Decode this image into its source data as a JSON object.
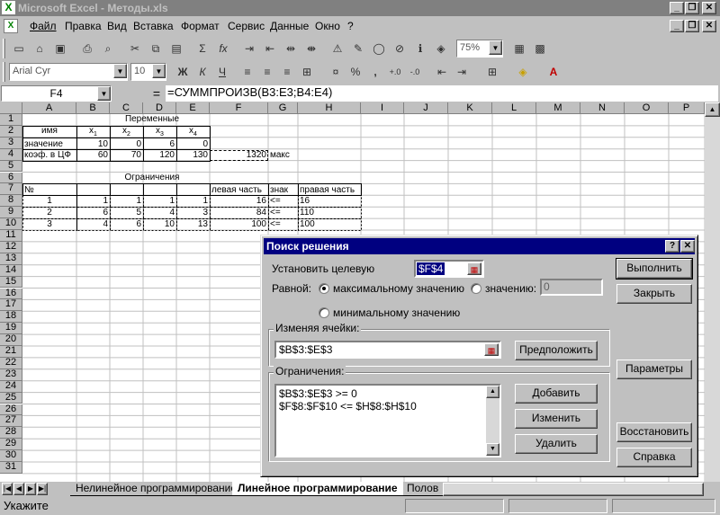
{
  "window": {
    "title": "Microsoft Excel - Методы.xls",
    "app_icon_letter": "X"
  },
  "menu": [
    "Файл",
    "Правка",
    "Вид",
    "Вставка",
    "Формат",
    "Сервис",
    "Данные",
    "Окно",
    "?"
  ],
  "toolbar": {
    "zoom": "75%",
    "font_name": "Arial Cyr",
    "font_size": "10",
    "bold": "Ж",
    "italic": "К",
    "underline": "Ч",
    "percent": "%",
    "comma": ","
  },
  "formula_bar": {
    "name_box": "F4",
    "equals": "=",
    "formula": "=СУММПРОИЗВ(B3:E3;B4:E4)"
  },
  "columns": [
    "A",
    "B",
    "C",
    "D",
    "E",
    "F",
    "G",
    "H",
    "I",
    "J",
    "K",
    "L",
    "M",
    "N",
    "O",
    "P"
  ],
  "rows": [
    "1",
    "2",
    "3",
    "4",
    "5",
    "6",
    "7",
    "8",
    "9",
    "10",
    "11",
    "12",
    "13",
    "14",
    "15",
    "16",
    "17",
    "18",
    "19",
    "20",
    "21",
    "22",
    "23",
    "24",
    "25",
    "26",
    "27",
    "28",
    "29",
    "30",
    "31"
  ],
  "sheet": {
    "variables_title": "Переменные",
    "name_header": "имя",
    "x_headers": [
      "x1",
      "x2",
      "x3",
      "x4"
    ],
    "row_value_label": "значение",
    "values": [
      "10",
      "0",
      "6",
      "0"
    ],
    "row_coef_label": "коэф. в ЦФ",
    "coefs": [
      "60",
      "70",
      "120",
      "130"
    ],
    "objective_value": "1320",
    "objective_label": "макс",
    "constraints_title": "Ограничения",
    "constraint_headers": {
      "num": "№",
      "left": "левая часть",
      "sign": "знак",
      "right": "правая часть"
    },
    "constraints": [
      {
        "n": "1",
        "b": "1",
        "c": "1",
        "d": "1",
        "e": "1",
        "left": "16",
        "sign": "<=",
        "right": "16"
      },
      {
        "n": "2",
        "b": "6",
        "c": "5",
        "d": "4",
        "e": "3",
        "left": "84",
        "sign": "<=",
        "right": "110"
      },
      {
        "n": "3",
        "b": "4",
        "c": "6",
        "d": "10",
        "e": "13",
        "left": "100",
        "sign": "<=",
        "right": "100"
      }
    ]
  },
  "tabs": [
    "Нелинейное программирование",
    "Линейное программирование",
    "Полов"
  ],
  "status": "Укажите",
  "dialog": {
    "title": "Поиск решения",
    "help_glyph": "?",
    "close_glyph": "✕",
    "target_label": "Установить целевую",
    "target_value": "$F$4",
    "equal_label": "Равной:",
    "opt_max": "максимальному значению",
    "opt_value": "значению:",
    "opt_value_input": "0",
    "opt_min": "минимальному значению",
    "changing_label": "Изменяя ячейки:",
    "changing_value": "$B$3:$E$3",
    "guess_button": "Предположить",
    "constraints_label": "Ограничения:",
    "constraints": [
      "$B$3:$E$3 >= 0",
      "$F$8:$F$10 <= $H$8:$H$10"
    ],
    "add_button": "Добавить",
    "change_button": "Изменить",
    "delete_button": "Удалить",
    "run_button": "Выполнить",
    "close_button": "Закрыть",
    "params_button": "Параметры",
    "reset_button": "Восстановить",
    "help_button": "Справка"
  }
}
